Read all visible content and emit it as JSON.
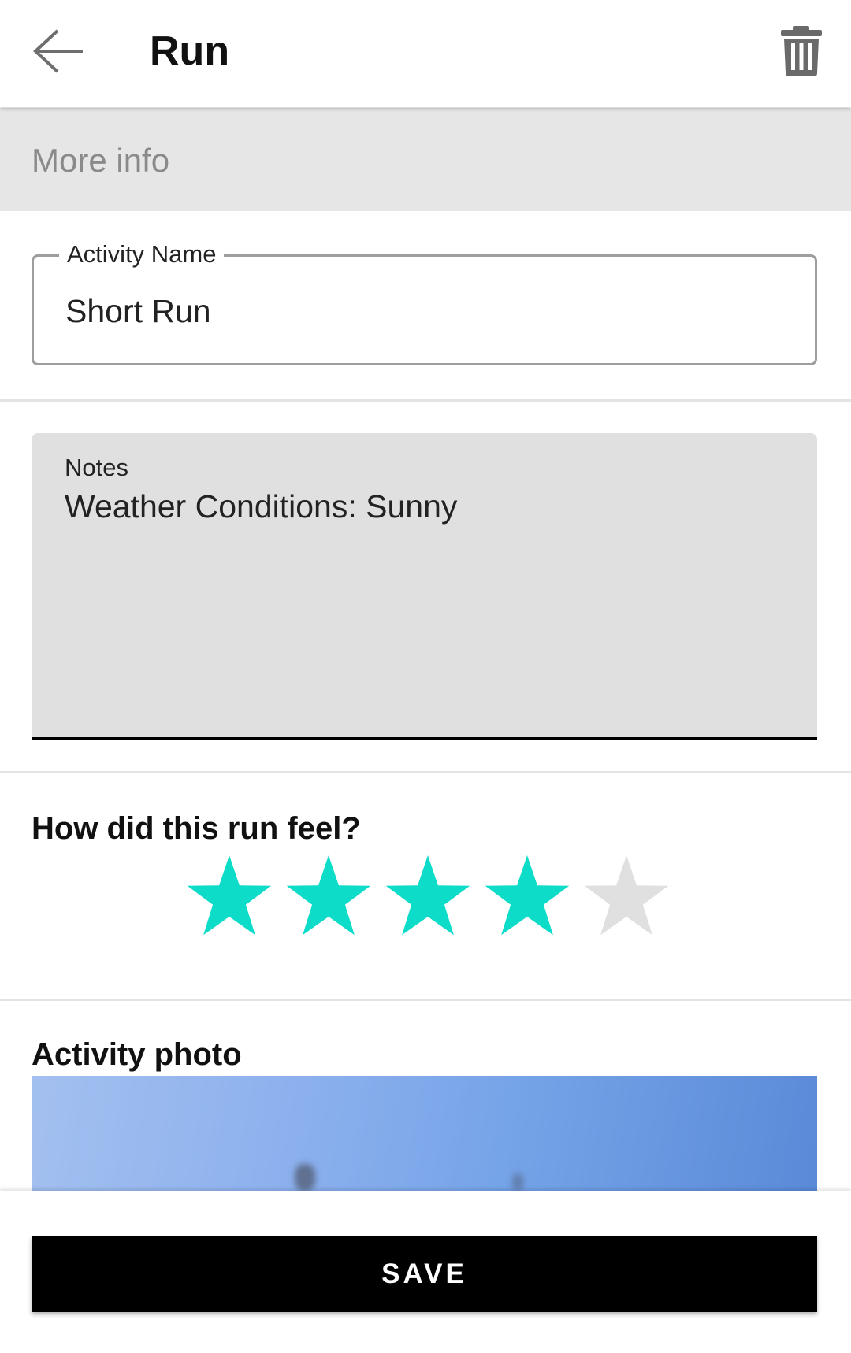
{
  "app_bar": {
    "back_icon": "arrow-left-icon",
    "title": "Run",
    "delete_icon": "trash-icon"
  },
  "section": {
    "more_info_label": "More info"
  },
  "activity_name_field": {
    "label": "Activity Name",
    "value": "Short Run"
  },
  "notes_field": {
    "label": "Notes",
    "value": "Weather Conditions: Sunny"
  },
  "rating": {
    "question": "How did this run feel?",
    "value": 4,
    "max": 5,
    "filled_color": "#0cdcc8",
    "empty_color": "#e0e0e0"
  },
  "photo": {
    "heading": "Activity photo"
  },
  "save_button": {
    "label": "SAVE"
  }
}
